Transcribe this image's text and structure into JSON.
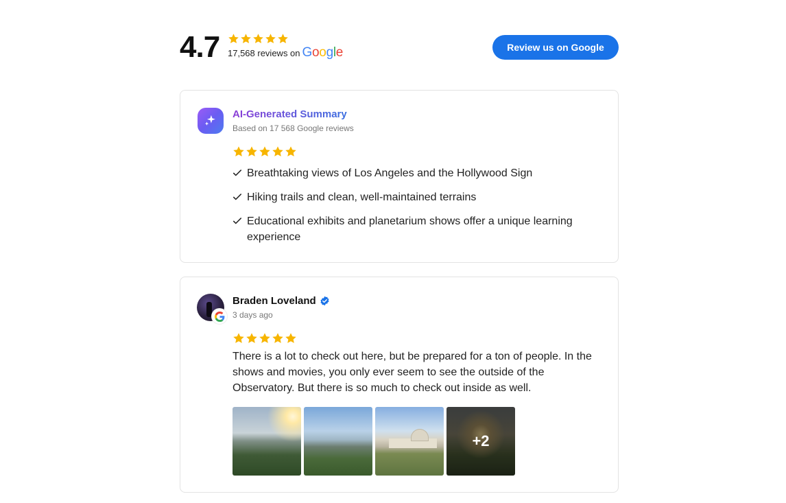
{
  "header": {
    "score": "4.7",
    "rating_stars": 5,
    "reviews_count_text": "17,568 reviews on",
    "google_word": "Google",
    "review_button_label": "Review us on Google"
  },
  "colors": {
    "star": "#F7B500",
    "button": "#1A73E8",
    "google_blue": "#4285F4",
    "google_red": "#EA4335",
    "google_yellow": "#FBBC05",
    "google_green": "#34A853",
    "verified": "#1A73E8"
  },
  "summary": {
    "icon": "sparkle-icon",
    "title": "AI-Generated Summary",
    "subtitle": "Based on 17 568 Google reviews",
    "stars": 5,
    "points": [
      "Breathtaking views of Los Angeles and the Hollywood Sign",
      "Hiking trails and clean, well-maintained terrains",
      "Educational exhibits and planetarium shows offer a unique learning experience"
    ]
  },
  "review": {
    "name": "Braden Loveland",
    "verified": true,
    "date": "3 days ago",
    "stars": 5,
    "text": "There is a lot to check out here, but be prepared for a ton of people. In the shows and movies, you only ever seem to see the outside of the Observatory. But there is so much to check out inside as well.",
    "photos_shown": 4,
    "more_photos_label": "+2"
  }
}
